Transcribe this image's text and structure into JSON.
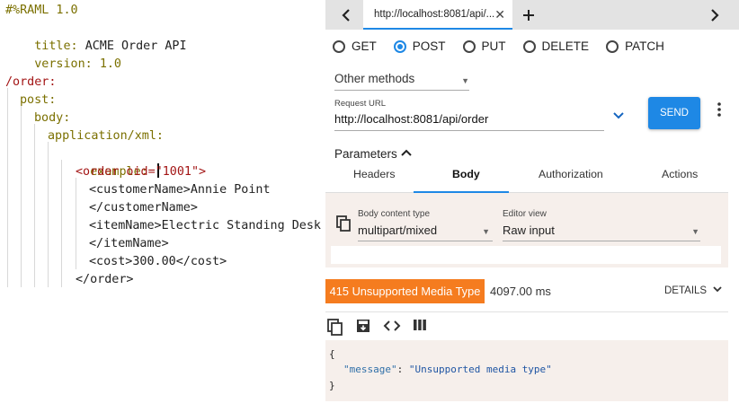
{
  "editor": {
    "header": "#%RAML 1.0",
    "title_key": "title:",
    "title_value": "ACME Order API",
    "version_key": "version:",
    "version_value": "1.0",
    "resource": "/order:",
    "method": "post:",
    "body": "body:",
    "media_type": "application/xml:",
    "example": "example:",
    "xml": {
      "order_open": "<order oid=\"1001\">",
      "customer_open": "<customerName>Annie Point",
      "customer_close": "</customerName>",
      "item_open": "<itemName>Electric Standing Desk",
      "item_close": "</itemName>",
      "cost": "<cost>300.00</cost>",
      "order_close": "</order>"
    }
  },
  "console": {
    "tabbar": {
      "back_icon": "chevron-left",
      "tab_title": "http://localhost:8081/api/...",
      "close_icon": "close",
      "add_icon": "plus",
      "forward_icon": "chevron-right"
    },
    "methods": [
      {
        "label": "GET",
        "selected": false
      },
      {
        "label": "POST",
        "selected": true
      },
      {
        "label": "PUT",
        "selected": false
      },
      {
        "label": "DELETE",
        "selected": false
      },
      {
        "label": "PATCH",
        "selected": false
      }
    ],
    "other_methods": "Other methods",
    "request_url_label": "Request URL",
    "request_url": "http://localhost:8081/api/order",
    "send_label": "SEND",
    "parameters_label": "Parameters",
    "subtabs": [
      "Headers",
      "Body",
      "Authorization",
      "Actions"
    ],
    "active_subtab": "Body",
    "body_content_type_label": "Body content type",
    "body_content_type": "multipart/mixed",
    "editor_view_label": "Editor view",
    "editor_view": "Raw input",
    "status": "415 Unsupported Media Type",
    "time": "4097.00 ms",
    "details_label": "DETAILS",
    "response": {
      "open": "{",
      "key": "\"message\"",
      "value": "\"Unsupported media type\"",
      "close": "}"
    },
    "colors": {
      "accent": "#1e88e5",
      "status_error": "#f57c1f",
      "card_bg": "#f6efeb",
      "tabbar_bg": "#e3e3e3"
    }
  }
}
